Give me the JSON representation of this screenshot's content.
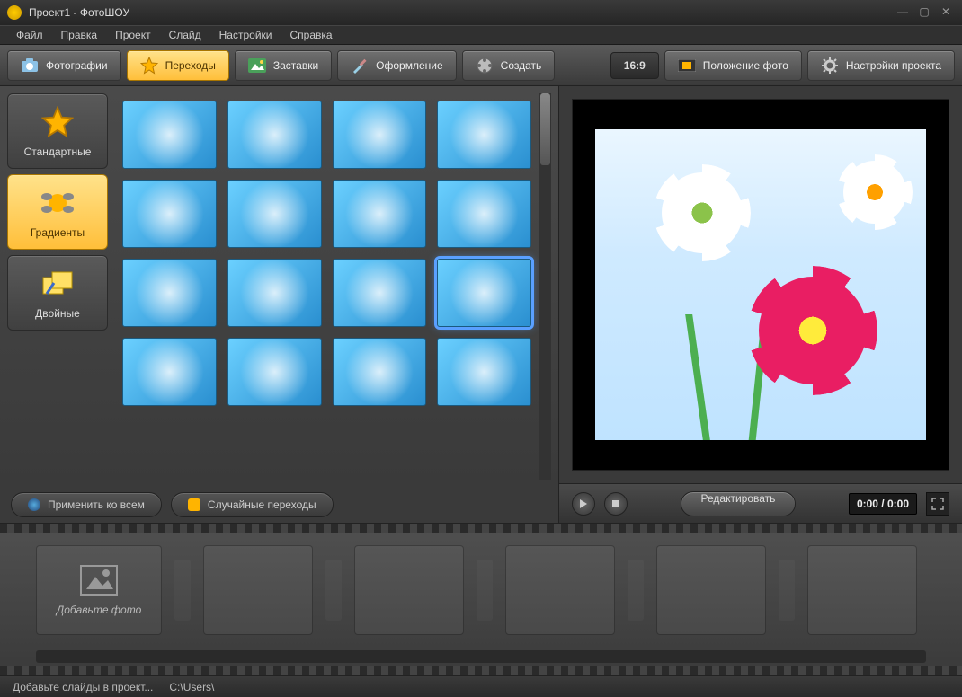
{
  "window": {
    "title": "Проект1 - ФотоШОУ"
  },
  "menu": {
    "items": [
      "Файл",
      "Правка",
      "Проект",
      "Слайд",
      "Настройки",
      "Справка"
    ]
  },
  "toolbar": {
    "photos": "Фотографии",
    "transitions": "Переходы",
    "templates": "Заставки",
    "design": "Оформление",
    "create": "Создать",
    "ratio": "16:9",
    "photo_pos": "Положение фото",
    "project_settings": "Настройки проекта"
  },
  "categories": {
    "standard": "Стандартные",
    "gradients": "Градиенты",
    "double": "Двойные"
  },
  "gallery": {
    "apply_all": "Применить ко всем",
    "random": "Случайные переходы"
  },
  "preview": {
    "edit": "Редактировать",
    "time": "0:00 / 0:00"
  },
  "timeline": {
    "add_photo": "Добавьте фото"
  },
  "status": {
    "hint": "Добавьте слайды в проект...",
    "path": "C:\\Users\\"
  }
}
